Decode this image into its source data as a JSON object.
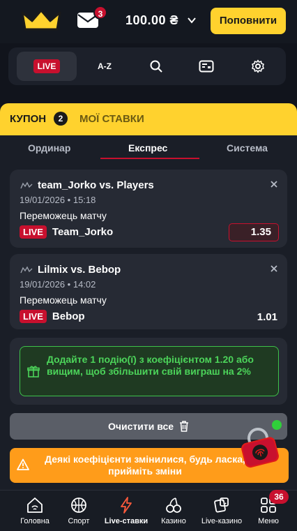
{
  "header": {
    "mail_badge": "3",
    "balance": "100.00 ₴",
    "topup_label": "Поповнити"
  },
  "nav": {
    "live_label": "LIVE",
    "az_label": "A-Z"
  },
  "coupon": {
    "title": "КУПОН",
    "count": "2",
    "my_bets_label": "МОЇ СТАВКИ",
    "tabs": [
      {
        "label": "Ординар",
        "active": false
      },
      {
        "label": "Експрес",
        "active": true
      },
      {
        "label": "Система",
        "active": false
      }
    ],
    "bets": [
      {
        "title": "team_Jorko vs. Players",
        "date": "19/01/2026 • 15:18",
        "market": "Переможець матчу",
        "live_tag": "LIVE",
        "pick": "Team_Jorko",
        "odds": "1.35"
      },
      {
        "title": "Lilmix vs. Bebop",
        "date": "19/01/2026 • 14:02",
        "market": "Переможець матчу",
        "live_tag": "LIVE",
        "pick": "Bebop",
        "odds": "1.01"
      }
    ],
    "promo_text": "Додайте 1 подію(ї) з коефіцієнтом 1.20 або вищим, щоб збільшити свій виграш на 2%",
    "clear_label": "Очистити все",
    "warning_text": "Деякі коефіцієнти змінилися, будь ласка, прийміть зміни"
  },
  "bottom_nav": {
    "items": [
      {
        "label": "Головна",
        "icon": "home-icon"
      },
      {
        "label": "Спорт",
        "icon": "basketball-icon"
      },
      {
        "label": "Live-ставки",
        "icon": "lightning-icon"
      },
      {
        "label": "Казино",
        "icon": "cherries-icon"
      },
      {
        "label": "Live-казино",
        "icon": "dice-cards-icon"
      },
      {
        "label": "Меню",
        "icon": "grid-icon"
      }
    ],
    "menu_badge": "36"
  },
  "colors": {
    "accent_yellow": "#ffd22e",
    "live_red": "#c8102e",
    "promo_green": "#4cd45a",
    "warning_orange": "#ff9c1a",
    "background": "#11141c"
  }
}
